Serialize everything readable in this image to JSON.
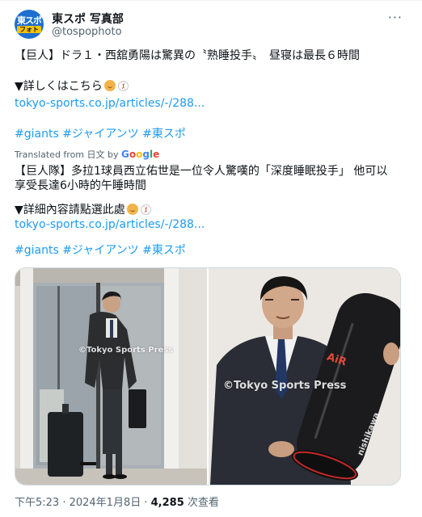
{
  "author": {
    "avatar_line1": "東スポ",
    "avatar_line2": "フォト",
    "name": "東スポ 写真部",
    "handle": "@tospophoto"
  },
  "tweet": {
    "line1": "【巨人】ドラ１・西舘勇陽は驚異の〝熟睡投手〟　昼寝は最長６時間",
    "details_prefix": "▼詳しくはこちら",
    "link": "tokyo-sports.co.jp/articles/-/288...",
    "hashtags": "#giants #ジャイアンツ #東スポ"
  },
  "translation": {
    "label": "Translated from 日文 by",
    "google": [
      "G",
      "o",
      "o",
      "g",
      "l",
      "e"
    ],
    "line1": "【巨人隊】多拉1球員西立佑世是一位令人驚嘆的「深度睡眠投手」 他可以",
    "line2": "享受長達6小時的午睡時間",
    "details_prefix": "▼詳細內容請點選此處",
    "link": "tokyo-sports.co.jp/articles/-/288...",
    "hashtags": "#giants #ジャイアンツ #東スポ"
  },
  "media": {
    "watermark1": "©Tokyo Sports Press",
    "watermark2": "©Tokyo Sports Press",
    "bag_brand": "AiR",
    "bag_name": "nishikawa"
  },
  "footer": {
    "time_date": "下午5:23 · 2024年1月8日 · ",
    "views_count": "4,285",
    "views_label": " 次查看"
  },
  "colors": {
    "link": "#1d9bf0",
    "secondary_text": "#536471",
    "avatar_bg": "#1e6fd0"
  }
}
